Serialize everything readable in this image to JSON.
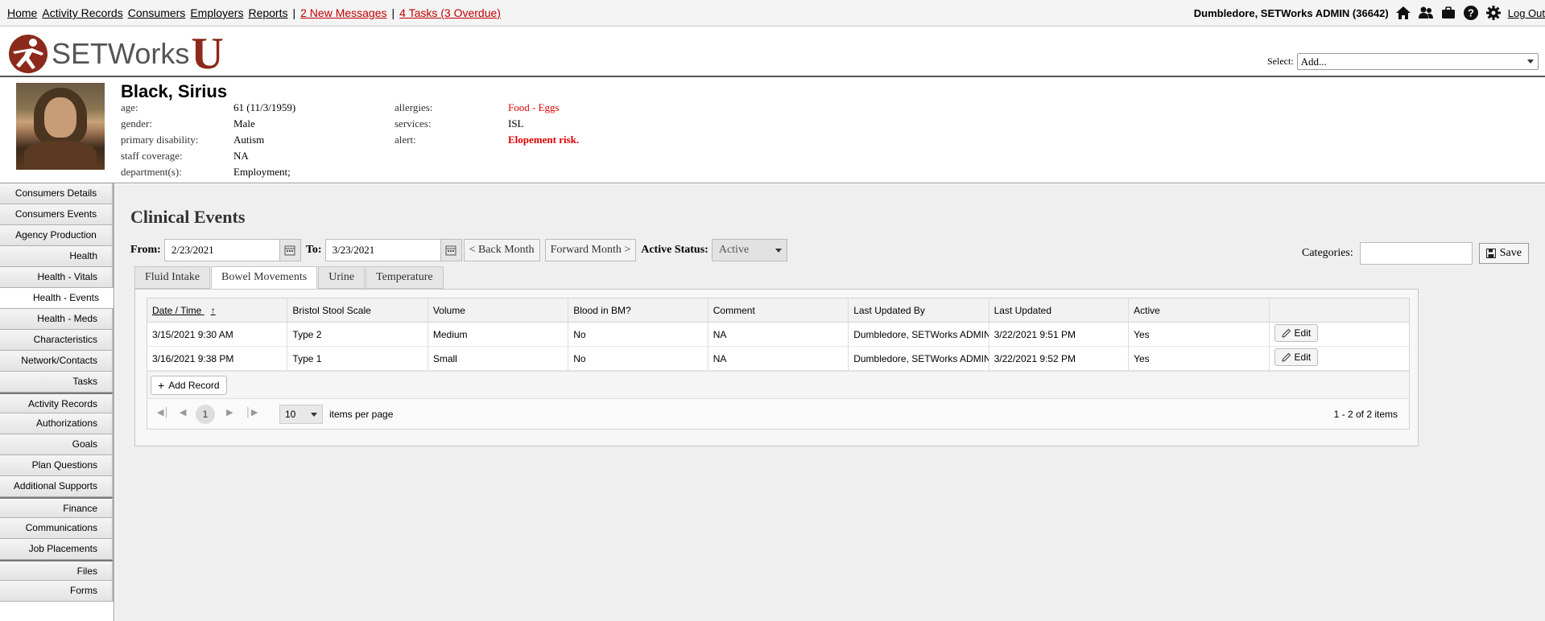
{
  "topnav": {
    "links": [
      "Home",
      "Activity Records",
      "Consumers",
      "Employers",
      "Reports"
    ],
    "messages": "2 New Messages",
    "tasks": "4 Tasks (3 Overdue)",
    "separator": "|"
  },
  "user": {
    "name": "Dumbledore, SETWorks ADMIN  (36642)",
    "logout": "Log Out"
  },
  "logo": {
    "word": "SETWorks",
    "letter": "U"
  },
  "select": {
    "label": "Select:",
    "value": "Add..."
  },
  "consumer": {
    "name": "Black, Sirius",
    "age_label": "age:",
    "age": "61 (11/3/1959)",
    "gender_label": "gender:",
    "gender": "Male",
    "disability_label": "primary disability:",
    "disability": "Autism",
    "coverage_label": "staff coverage:",
    "coverage": "NA",
    "department_label": "department(s):",
    "department": "Employment;",
    "allergies_label": "allergies:",
    "allergies": "Food - Eggs",
    "services_label": "services:",
    "services": "ISL",
    "alert_label": "alert:",
    "alert": "Elopement risk."
  },
  "sidebar": {
    "items": [
      "Consumers Details",
      "Consumers Events",
      "Agency Production",
      "Health",
      "Health - Vitals",
      "Health - Events",
      "Health - Meds",
      "Characteristics",
      "Network/Contacts",
      "Tasks",
      "Activity Records",
      "Authorizations",
      "Goals",
      "Plan Questions",
      "Additional Supports",
      "Finance",
      "Communications",
      "Job Placements",
      "Files",
      "Forms"
    ],
    "active": "Health - Events"
  },
  "page": {
    "title": "Clinical Events",
    "from_label": "From:",
    "from": "2/23/2021",
    "to_label": "To:",
    "to": "3/23/2021",
    "back_month": "< Back Month",
    "forward_month": "Forward Month >",
    "status_label": "Active Status:",
    "status": "Active",
    "categories_label": "Categories:",
    "save": "Save"
  },
  "tabs": [
    "Fluid Intake",
    "Bowel Movements",
    "Urine",
    "Temperature"
  ],
  "selected_tab": "Bowel Movements",
  "grid": {
    "columns": [
      "Date / Time",
      "Bristol Stool Scale",
      "Volume",
      "Blood in BM?",
      "Comment",
      "Last Updated By",
      "Last Updated",
      "Active",
      ""
    ],
    "rows": [
      [
        "3/15/2021 9:30 AM",
        "Type 2",
        "Medium",
        "No",
        "NA",
        "Dumbledore, SETWorks ADMIN",
        "3/22/2021 9:51 PM",
        "Yes"
      ],
      [
        "3/16/2021 9:38 PM",
        "Type 1",
        "Small",
        "No",
        "NA",
        "Dumbledore, SETWorks ADMIN",
        "3/22/2021 9:52 PM",
        "Yes"
      ]
    ],
    "edit_label": "Edit",
    "add_record": "Add Record",
    "page": "1",
    "page_size": "10",
    "items_per_page": "items per page",
    "count": "1 - 2 of 2 items"
  },
  "colors": {
    "alert_red": "#e00000",
    "link_red": "#c00000",
    "logo_red": "#8b2a1c"
  }
}
